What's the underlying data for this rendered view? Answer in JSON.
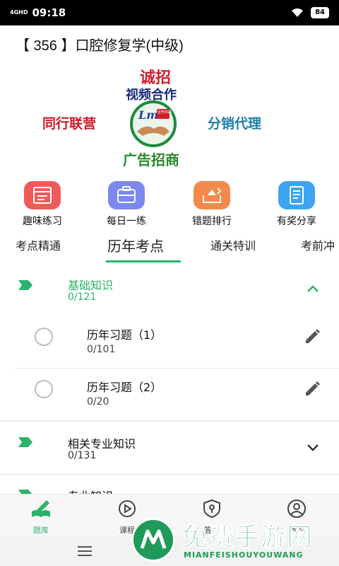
{
  "status": {
    "time": "09:18",
    "network": "4GHD",
    "battery": "84"
  },
  "page": {
    "title": "【 356 】口腔修复学(中级)"
  },
  "banner": {
    "line1": "诚招",
    "line2": "视频合作",
    "left": "同行联营",
    "right": "分销代理",
    "bottom": "广告招商",
    "logo_text": "Lm",
    "logo_small": "合作共赢"
  },
  "quick_actions": [
    {
      "label": "趣味练习",
      "icon": "browser-window-icon",
      "color": "#ef5b5b"
    },
    {
      "label": "每日一练",
      "icon": "briefcase-icon",
      "color": "#7b88ee"
    },
    {
      "label": "错题排行",
      "icon": "inbox-export-icon",
      "color": "#f38a4c"
    },
    {
      "label": "有奖分享",
      "icon": "notebook-icon",
      "color": "#3ea4f1"
    }
  ],
  "tabs": [
    {
      "label": "考点精通"
    },
    {
      "label": "历年考点",
      "active": true
    },
    {
      "label": "通关特训"
    },
    {
      "label": "考前冲"
    }
  ],
  "sections": [
    {
      "title": "基础知识",
      "count": "0/121",
      "expanded": true,
      "items": [
        {
          "title": "历年习题（1）",
          "count": "0/101"
        },
        {
          "title": "历年习题（2）",
          "count": "0/20"
        }
      ]
    },
    {
      "title": "相关专业知识",
      "count": "0/131",
      "expanded": false
    },
    {
      "title": "专业知识",
      "count": "",
      "expanded": false
    }
  ],
  "bottom_nav": [
    {
      "label": "题库",
      "icon": "book-pen-icon",
      "active": true
    },
    {
      "label": "课程",
      "icon": "play-icon",
      "active": false
    },
    {
      "label": "答卷",
      "icon": "shield-key-icon",
      "active": false
    },
    {
      "label": "我的",
      "icon": "user-icon",
      "active": false
    }
  ],
  "watermark": {
    "title": "免费手游网",
    "subtitle": "MIANFEISHOUYOUWANG"
  },
  "colors": {
    "accent": "#2bb36b"
  }
}
